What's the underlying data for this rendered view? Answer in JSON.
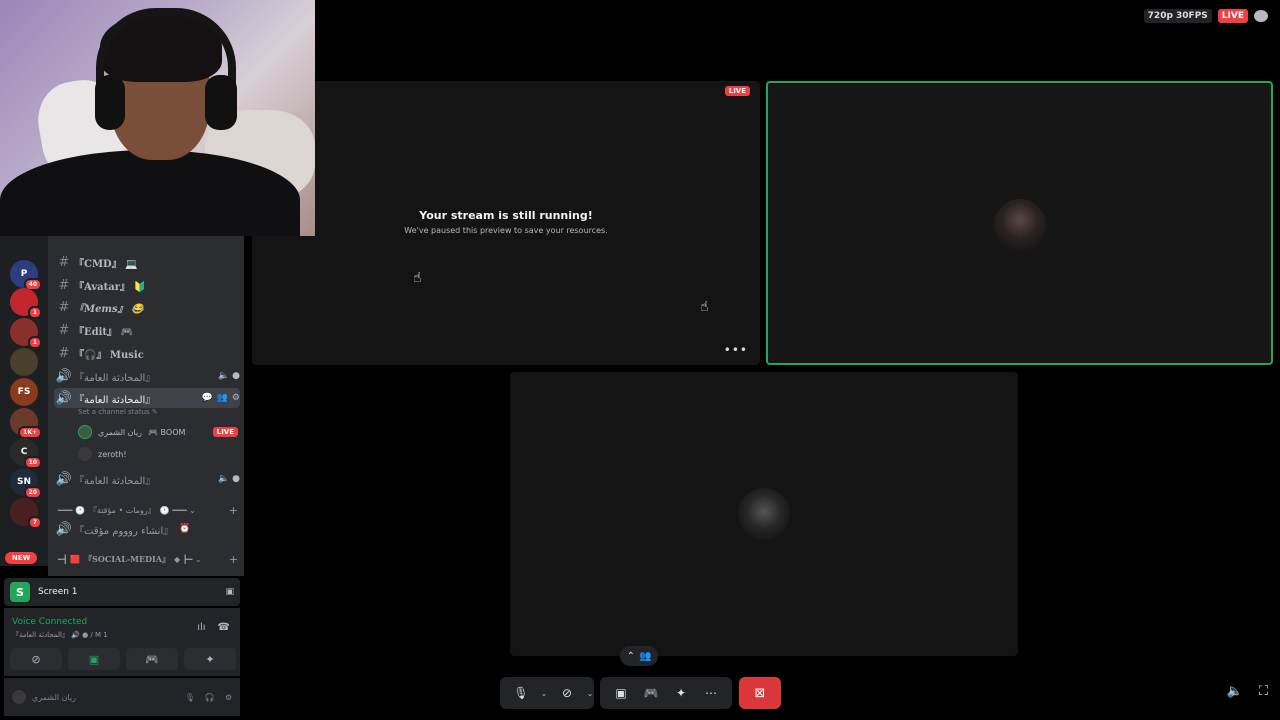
{
  "channels": [
    {
      "icon": "#",
      "name": "『CMD』 💻"
    },
    {
      "icon": "#",
      "name": "『Avatar』 🔰"
    },
    {
      "icon": "#",
      "name": "『Mems』 😂"
    },
    {
      "icon": "#",
      "name": "『Edit』 🎮"
    },
    {
      "icon": "#",
      "name": "『🎧』 Music"
    }
  ],
  "voice_channels": {
    "vc1": "『المحادثة العامة』",
    "vc2_active": "『المحادثة العامة』",
    "vc2_status": "Set a channel status ✎",
    "vc3": "『المحادثة العامة』",
    "cat1": "『رومات • مؤقتة』",
    "vc4": "『انشاء روووم مؤقت』",
    "cat2": "『SOCIAL-MEDIA』"
  },
  "voice_users": [
    {
      "name": "ريان الشمري",
      "activity": "🎮 BOOM",
      "live": "LIVE"
    },
    {
      "name": "zeroth!",
      "activity": "",
      "live": ""
    }
  ],
  "servers": [
    {
      "label": "P",
      "color": "#2b3f7e",
      "badge": "40"
    },
    {
      "label": "",
      "color": "#c2272d",
      "badge": "1"
    },
    {
      "label": "",
      "color": "#8b2e2e",
      "badge": "1"
    },
    {
      "label": "",
      "color": "#4a3f2a",
      "badge": ""
    },
    {
      "label": "FS",
      "color": "#8a3b1e",
      "badge": ""
    },
    {
      "label": "",
      "color": "#6b3a2a",
      "badge": "1K+"
    },
    {
      "label": "C",
      "color": "#2a2a2a",
      "badge": "10"
    },
    {
      "label": "SN",
      "color": "#1f2a3a",
      "badge": "20"
    },
    {
      "label": "",
      "color": "#4a1f1f",
      "badge": "7"
    }
  ],
  "new_badge": "NEW",
  "panel": {
    "screen_label": "Screen 1",
    "voice_connected": "Voice Connected",
    "voice_sub": "『المحادثة العامة』 🔊 ● / M 1",
    "username": "ريان الشمري"
  },
  "stage": {
    "quality": "720p 30FPS",
    "live": "LIVE",
    "stream_title": "Your stream is still running!",
    "stream_sub": "We've paused this preview to save your resources.",
    "tile_live": "LIVE",
    "tile_more": "•••"
  },
  "colors": {
    "accent_green": "#23a55a",
    "live_red": "#f23f43",
    "end_red": "#da373c",
    "sidebar": "#2b2d31"
  }
}
